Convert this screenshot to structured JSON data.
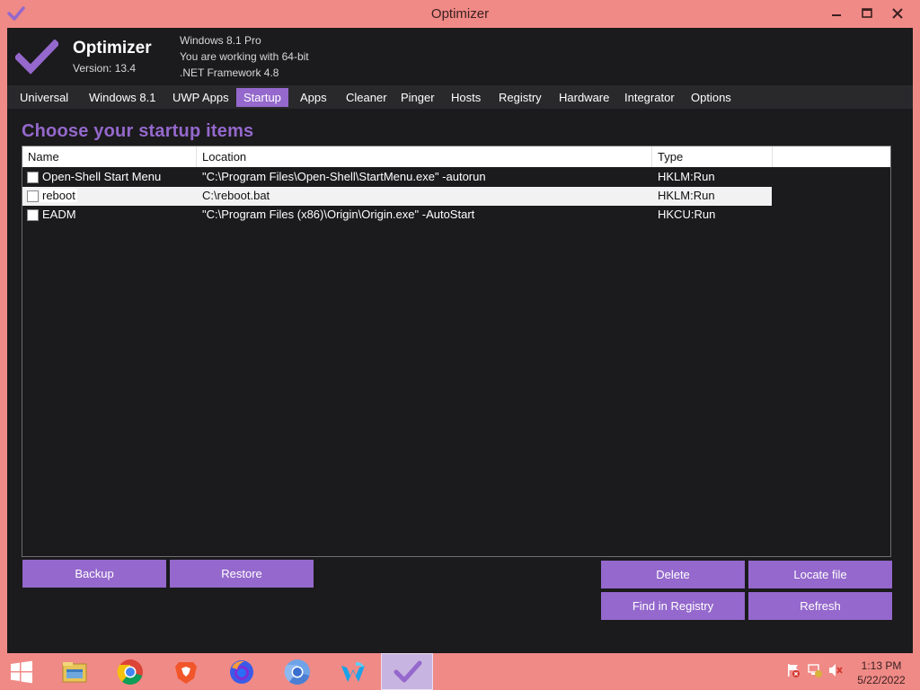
{
  "window": {
    "title": "Optimizer",
    "icon": "checkmark-icon",
    "controls": [
      "minimize-icon",
      "maximize-icon",
      "close-icon"
    ]
  },
  "header": {
    "app_name": "Optimizer",
    "version": "Version: 13.4",
    "os": "Windows 8.1 Pro",
    "arch": "You are working with 64-bit",
    "framework": ".NET Framework 4.8"
  },
  "tabs": [
    {
      "label": "Universal",
      "active": false
    },
    {
      "label": "Windows 8.1",
      "active": false
    },
    {
      "label": "UWP Apps",
      "active": false
    },
    {
      "label": "Startup",
      "active": true
    },
    {
      "label": "Apps",
      "active": false
    },
    {
      "label": "Cleaner",
      "active": false
    },
    {
      "label": "Pinger",
      "active": false
    },
    {
      "label": "Hosts",
      "active": false
    },
    {
      "label": "Registry",
      "active": false
    },
    {
      "label": "Hardware",
      "active": false
    },
    {
      "label": "Integrator",
      "active": false
    },
    {
      "label": "Options",
      "active": false
    }
  ],
  "startup": {
    "title": "Choose your startup items",
    "columns": [
      "Name",
      "Location",
      "Type"
    ],
    "rows": [
      {
        "name": "Open-Shell Start Menu",
        "location": "\"C:\\Program Files\\Open-Shell\\StartMenu.exe\" -autorun",
        "type": "HKLM:Run",
        "checked": false,
        "selected": false
      },
      {
        "name": "reboot",
        "location": "C:\\reboot.bat",
        "type": "HKLM:Run",
        "checked": false,
        "selected": true
      },
      {
        "name": "EADM",
        "location": "\"C:\\Program Files (x86)\\Origin\\Origin.exe\" -AutoStart",
        "type": "HKCU:Run",
        "checked": false,
        "selected": false
      }
    ],
    "buttons": {
      "backup": "Backup",
      "restore": "Restore",
      "delete": "Delete",
      "locate": "Locate file",
      "find_registry": "Find in Registry",
      "refresh": "Refresh"
    }
  },
  "taskbar": {
    "apps": [
      "windows-start-icon",
      "file-explorer-icon",
      "chrome-icon",
      "brave-icon",
      "firefox-icon",
      "chromium-icon",
      "waterfox-icon",
      "optimizer-icon"
    ],
    "tray": [
      "action-center-flag-icon",
      "network-icon",
      "volume-muted-icon"
    ],
    "time": "1:13 PM",
    "date": "5/22/2022"
  },
  "colors": {
    "accent": "#9468cc",
    "title_bar": "#f08a86",
    "background": "#1b1a1c"
  }
}
